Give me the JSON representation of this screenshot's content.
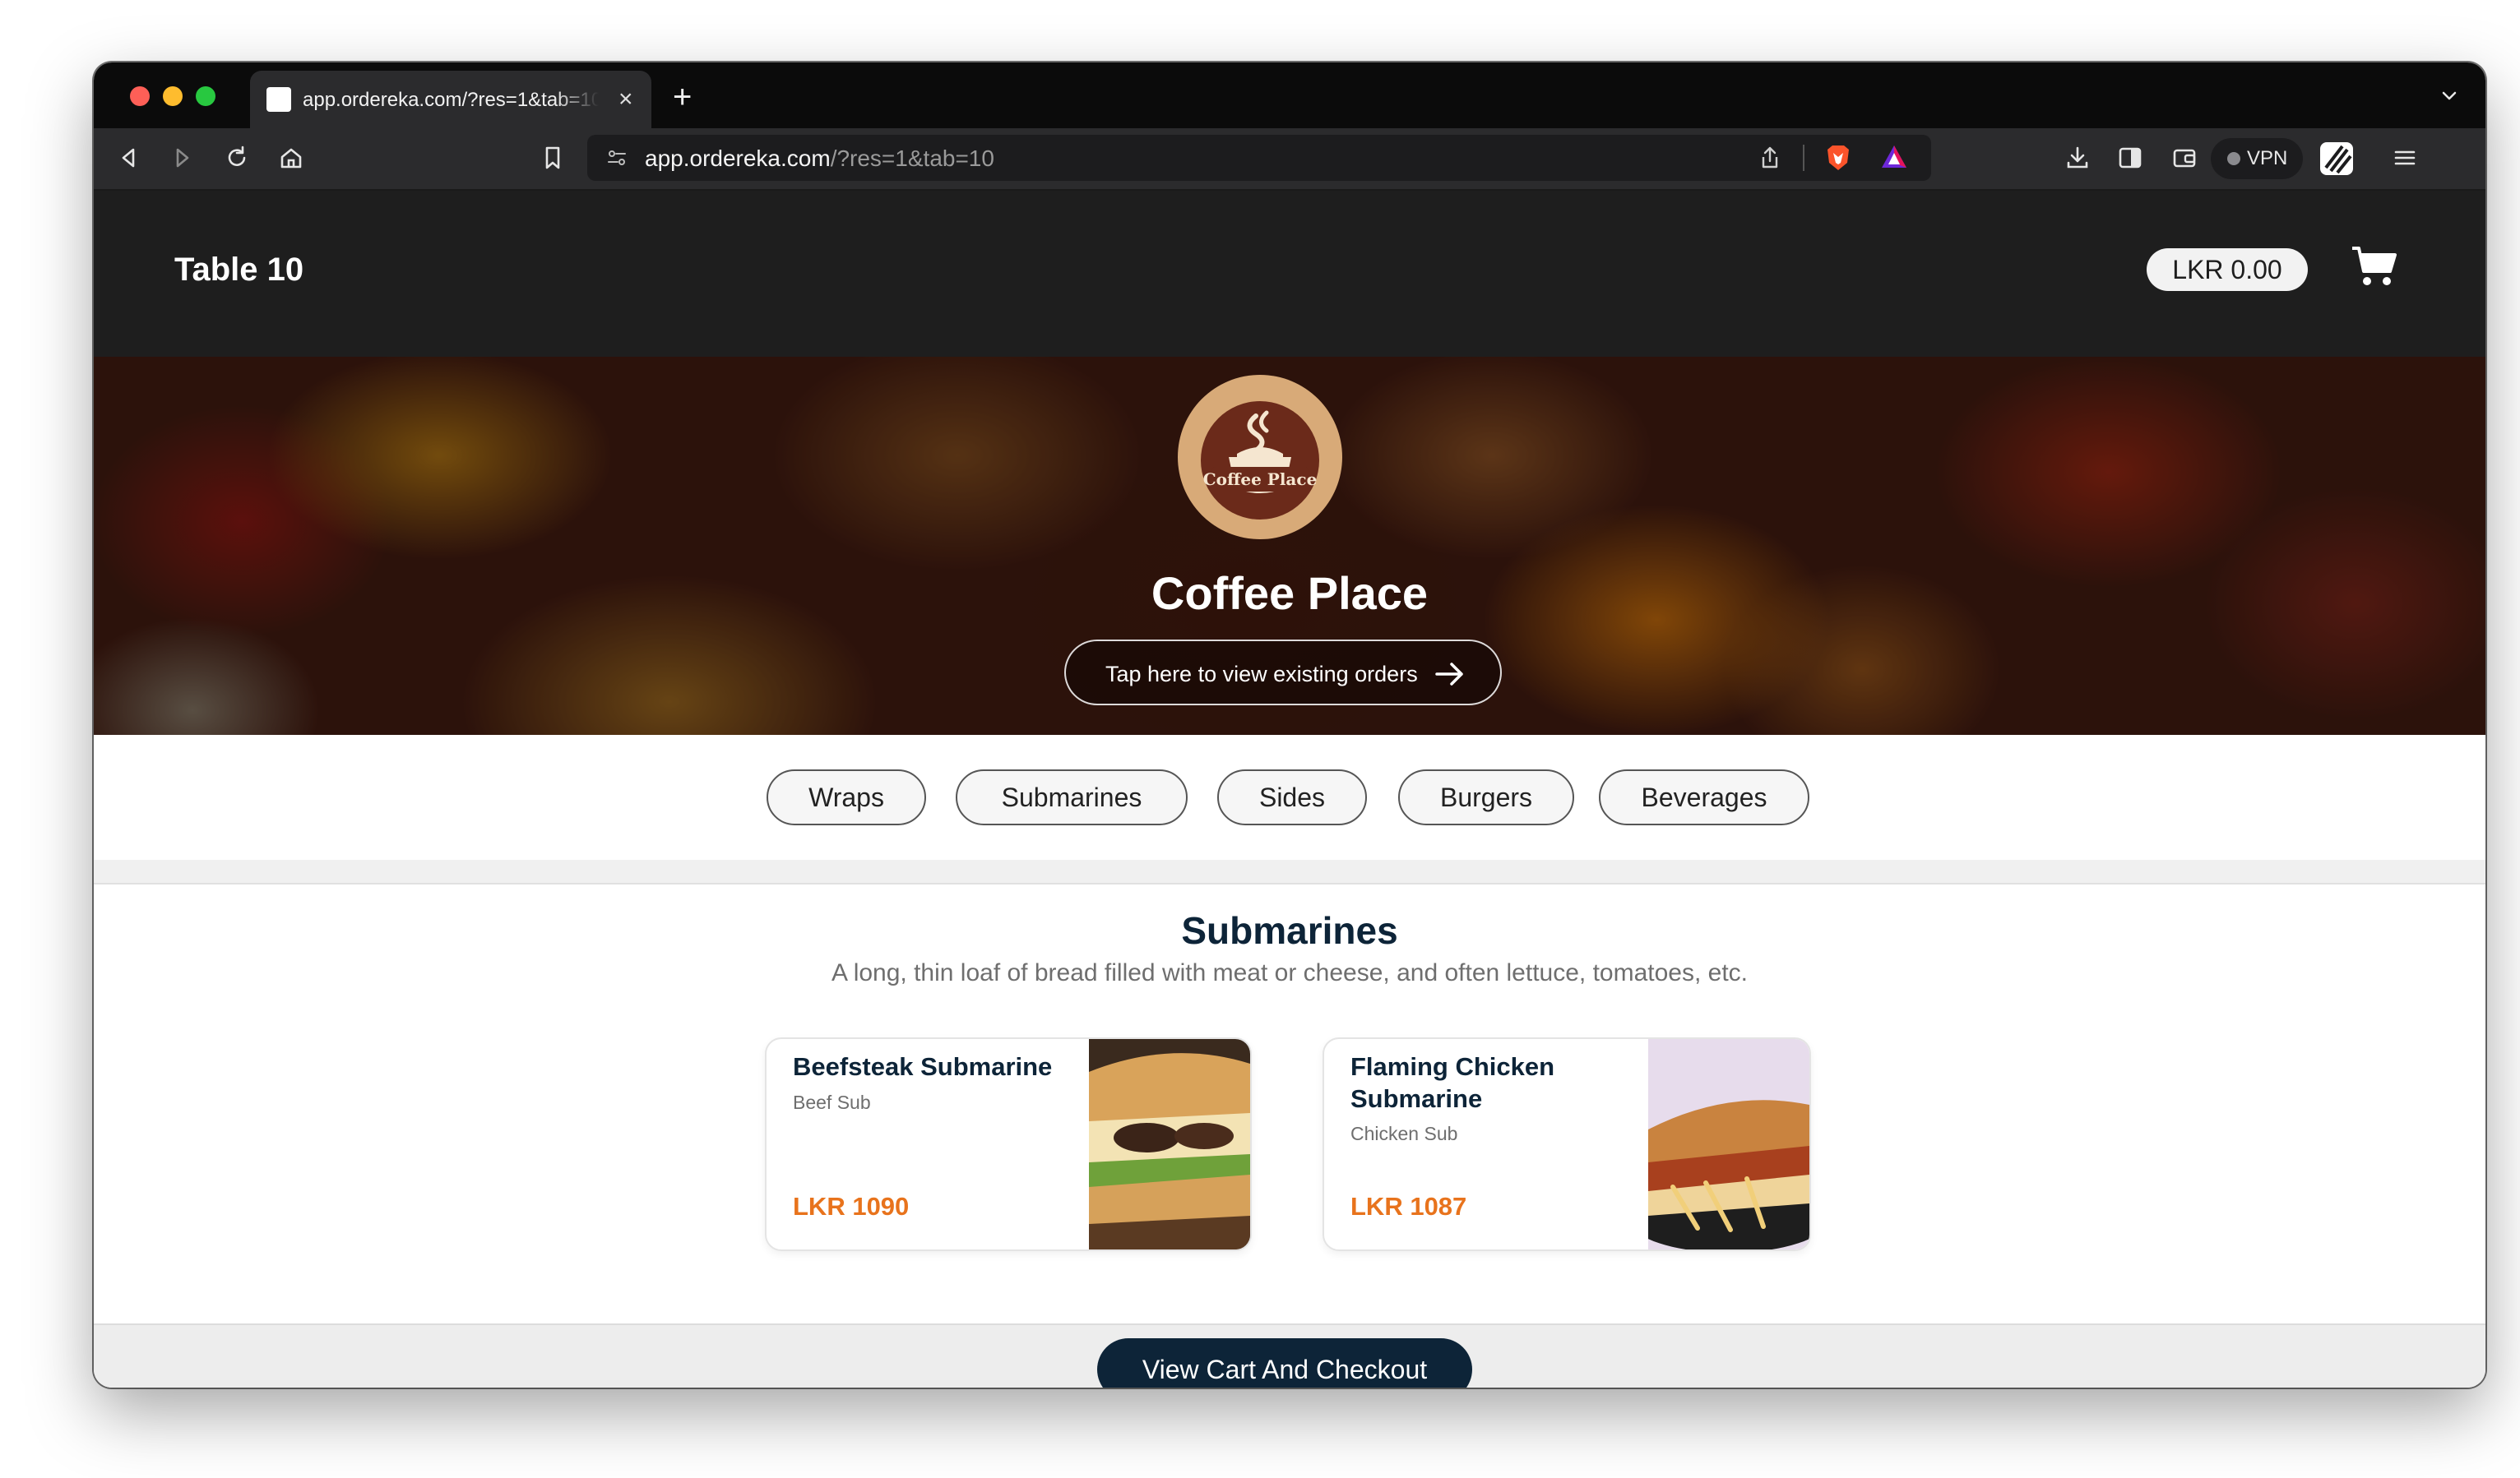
{
  "browser": {
    "tab_title": "app.ordereka.com/?res=1&tab=10",
    "url_host": "app.ordereka.com",
    "url_path": "/?res=1&tab=10",
    "vpn_label": "VPN"
  },
  "header": {
    "table_label": "Table 10",
    "cart_total": "LKR 0.00"
  },
  "hero": {
    "logo_text": "Coffee Place",
    "restaurant_name": "Coffee Place",
    "orders_button_label": "Tap here to view existing orders"
  },
  "categories": [
    "Wraps",
    "Submarines",
    "Sides",
    "Burgers",
    "Beverages"
  ],
  "section": {
    "title": "Submarines",
    "description": "A long, thin loaf of bread filled with meat or cheese, and often lettuce, tomatoes, etc."
  },
  "items": [
    {
      "name": "Beefsteak Submarine",
      "subtitle": "Beef Sub",
      "price": "LKR 1090"
    },
    {
      "name": "Flaming Chicken Submarine",
      "subtitle": "Chicken Sub",
      "price": "LKR 1087"
    }
  ],
  "checkout": {
    "label": "View Cart And Checkout"
  },
  "colors": {
    "accent_navy": "#0d2438",
    "price_orange": "#e8731c"
  }
}
